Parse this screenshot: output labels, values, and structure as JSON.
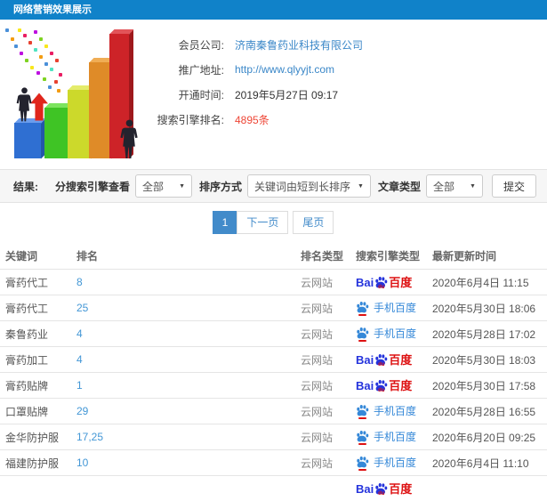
{
  "colors": {
    "topbar": "#1082c9",
    "link": "#3a87c8",
    "highlight": "#ee4636",
    "pagination_active": "#428bca",
    "baidu_blue": "#2534dc",
    "baidu_red": "#dd1112",
    "mobile_blue": "#3588d8"
  },
  "titlebar": {
    "title": "网络营销效果展示"
  },
  "account": {
    "fields": [
      {
        "label": "会员公司:",
        "value": "济南秦鲁药业科技有限公司"
      },
      {
        "label": "推广地址:",
        "value": "http://www.qlyyjt.com"
      },
      {
        "label": "开通时间:",
        "value": "2019年5月27日 09:17"
      },
      {
        "label": "搜索引擎排名:",
        "value": "4895条"
      }
    ]
  },
  "filters": {
    "section_label": "结果:",
    "engine_view_label": "分搜索引擎查看",
    "engine_view_value": "全部",
    "sort_label": "排序方式",
    "sort_value": "关键词由短到长排序",
    "article_type_label": "文章类型",
    "article_type_value": "全部",
    "submit_label": "提交"
  },
  "pagination": {
    "current": "1",
    "next": "下一页",
    "last": "尾页"
  },
  "table": {
    "headers": [
      "关键词",
      "排名",
      "排名类型",
      "搜索引擎类型",
      "最新更新时间"
    ],
    "engine_logos": {
      "baidu_pc": {
        "text_left": "Bai",
        "paw_text": "du",
        "text_right": "百度"
      },
      "baidu_mobile": {
        "text": "手机百度"
      }
    },
    "rows": [
      {
        "keyword": "膏药代工",
        "rank": "8",
        "rank_type": "云网站",
        "engine": "baidu_pc",
        "updated": "2020年6月4日 11:15"
      },
      {
        "keyword": "膏药代工",
        "rank": "25",
        "rank_type": "云网站",
        "engine": "baidu_mobile",
        "updated": "2020年5月30日 18:06"
      },
      {
        "keyword": "秦鲁药业",
        "rank": "4",
        "rank_type": "云网站",
        "engine": "baidu_mobile",
        "updated": "2020年5月28日 17:02"
      },
      {
        "keyword": "膏药加工",
        "rank": "4",
        "rank_type": "云网站",
        "engine": "baidu_pc",
        "updated": "2020年5月30日 18:03"
      },
      {
        "keyword": "膏药贴牌",
        "rank": "1",
        "rank_type": "云网站",
        "engine": "baidu_pc",
        "updated": "2020年5月30日 17:58"
      },
      {
        "keyword": "口罩贴牌",
        "rank": "29",
        "rank_type": "云网站",
        "engine": "baidu_mobile",
        "updated": "2020年5月28日 16:55"
      },
      {
        "keyword": "金华防护服",
        "rank": "17,25",
        "rank_type": "云网站",
        "engine": "baidu_mobile",
        "updated": "2020年6月20日 09:25"
      },
      {
        "keyword": "福建防护服",
        "rank": "10",
        "rank_type": "云网站",
        "engine": "baidu_mobile",
        "updated": "2020年6月4日 11:10"
      },
      {
        "keyword": "",
        "rank": "",
        "rank_type": "",
        "engine": "baidu_pc",
        "updated": "",
        "partial": true
      }
    ]
  }
}
